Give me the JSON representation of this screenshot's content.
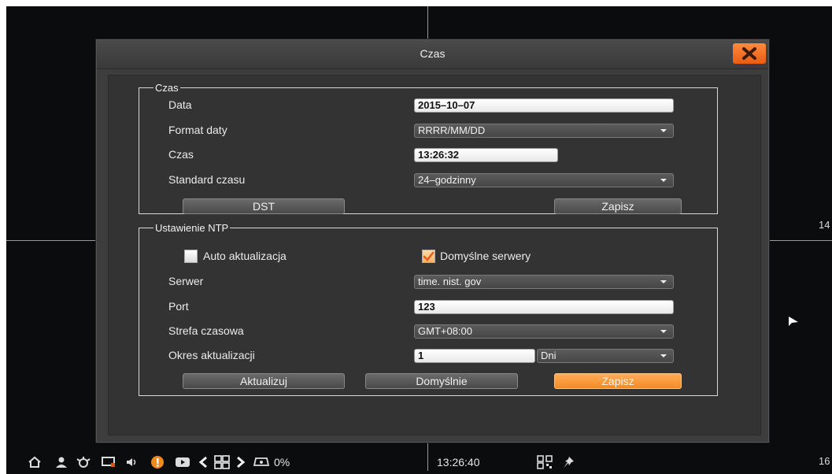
{
  "dialog": {
    "title": "Czas",
    "close_icon": "close-x-icon"
  },
  "time_section": {
    "legend": "Czas",
    "date_label": "Data",
    "date_value": "2015–10–07",
    "date_format_label": "Format daty",
    "date_format_value": "RRRR/MM/DD",
    "time_label": "Czas",
    "time_value": "13:26:32",
    "time_standard_label": "Standard czasu",
    "time_standard_value": "24–godzinny",
    "dst_button": "DST",
    "save_button": "Zapisz"
  },
  "ntp_section": {
    "legend": "Ustawienie NTP",
    "auto_update_label": "Auto aktualizacja",
    "auto_update_checked": false,
    "default_servers_label": "Domyślne serwery",
    "default_servers_checked": true,
    "server_label": "Serwer",
    "server_value": "time. nist. gov",
    "port_label": "Port",
    "port_value": "123",
    "timezone_label": "Strefa czasowa",
    "timezone_value": "GMT+08:00",
    "update_period_label": "Okres aktualizacji",
    "update_period_value": "1",
    "update_period_unit": "Dni",
    "update_button": "Aktualizuj",
    "defaults_button": "Domyślnie",
    "save_button": "Zapisz"
  },
  "background": {
    "edge_label_right_top": "14",
    "edge_label_right_bottom": "16"
  },
  "taskbar": {
    "icons": [
      "home-icon",
      "user-icon",
      "alarm-icon",
      "display-icon",
      "volume-icon",
      "alert-icon",
      "record-icon",
      "prev-icon",
      "grid-icon",
      "next-icon",
      "hdd-icon"
    ],
    "hdd_usage": "0%",
    "clock": "13:26:40",
    "extra_icons": [
      "qr-icon",
      "pin-icon"
    ]
  },
  "colors": {
    "accent": "#f38a24",
    "dialog_bg": "#3d3d3d",
    "panel_bg": "#333333"
  }
}
